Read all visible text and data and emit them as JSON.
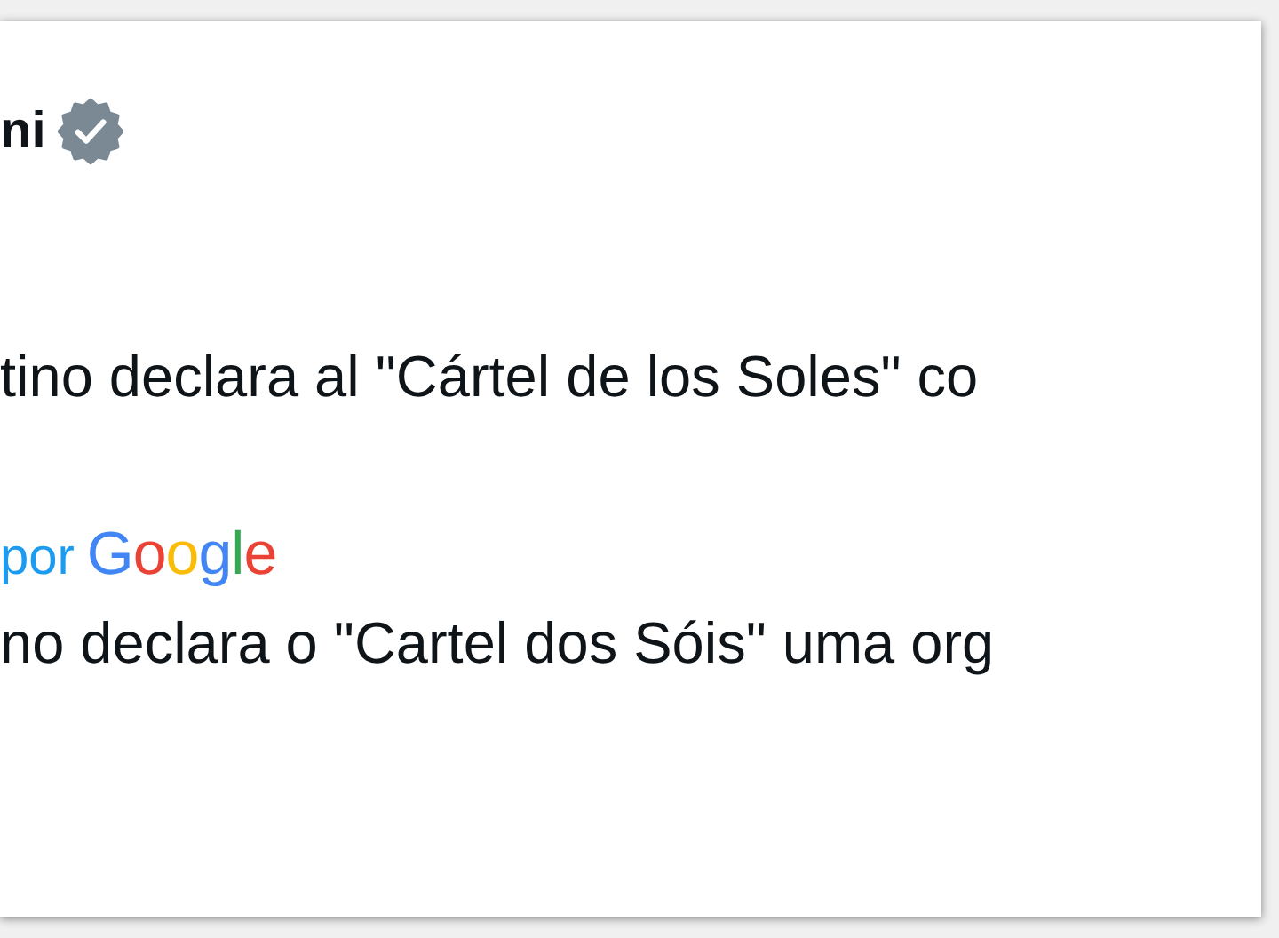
{
  "author": {
    "name": "ni",
    "verified": true
  },
  "original_text": "tino declara al \"Cártel de los Soles\" co",
  "translation": {
    "prefix": "por",
    "brand": "Google",
    "text": "no declara o \"Cartel dos Sóis\" uma org"
  }
}
